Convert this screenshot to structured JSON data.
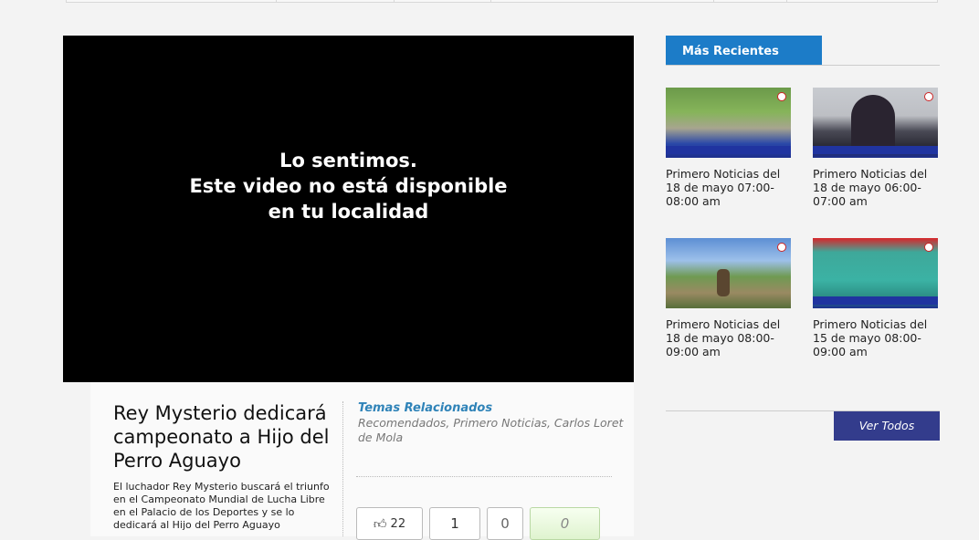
{
  "video": {
    "message_lines": [
      "Lo sentimos.",
      "Este video no está disponible",
      "en tu localidad"
    ]
  },
  "article": {
    "title": "Rey Mysterio dedicará campeonato a Hijo del Perro Aguayo",
    "description": "El luchador Rey Mysterio buscará el triunfo en el Campeonato Mundial de Lucha Libre en el Palacio de los Deportes y se lo dedicará al Hijo del Perro Aguayo"
  },
  "related": {
    "heading": "Temas Relacionados",
    "topics": "Recomendados, Primero Noticias, Carlos Loret de Mola"
  },
  "actions": {
    "like_count": "22",
    "share_count": "1",
    "comment_count": "0",
    "extra_count": "0",
    "like_icon": "thumbs-up-icon"
  },
  "sidebar": {
    "tab_label": "Más Recientes",
    "items": [
      {
        "caption": "Primero Noticias del 18 de mayo 07:00-08:00 am"
      },
      {
        "caption": "Primero Noticias del 18 de mayo 06:00-07:00 am"
      },
      {
        "caption": "Primero Noticias del 18 de mayo 08:00-09:00 am"
      },
      {
        "caption": "Primero Noticias del 15 de mayo 08:00-09:00 am"
      }
    ],
    "view_all_label": "Ver Todos"
  }
}
